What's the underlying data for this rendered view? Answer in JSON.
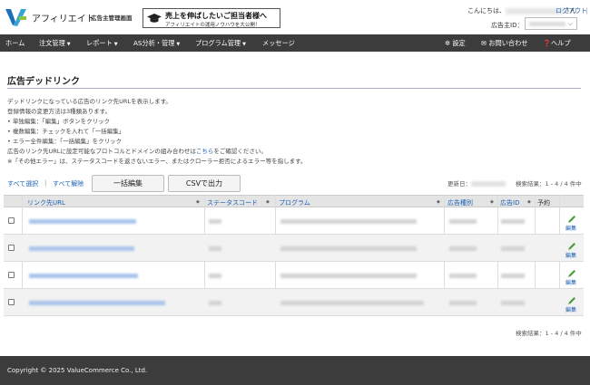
{
  "header": {
    "logo_text": "アフィリエイト",
    "logo_sub": "広告主管理画面",
    "banner_line1": "売上を伸ばしたいご担当者様へ",
    "banner_line2": "アフィリエイトの運用ノウハウを大公開！",
    "greeting_prefix": "こんにちは、",
    "greeting_suffix": "さん",
    "separator": "|",
    "logout": "ログアウト",
    "advertiser_label": "広告主ID："
  },
  "nav": {
    "items": [
      {
        "label": "ホーム",
        "caret": false
      },
      {
        "label": "注文管理",
        "caret": true
      },
      {
        "label": "レポート",
        "caret": true
      },
      {
        "label": "AS分析・管理",
        "caret": true
      },
      {
        "label": "プログラム管理",
        "caret": true
      },
      {
        "label": "メッセージ",
        "caret": false
      }
    ],
    "right": [
      {
        "label": "設定",
        "icon": "gear-icon"
      },
      {
        "label": "お問い合わせ",
        "icon": "mail-icon"
      },
      {
        "label": "ヘルプ",
        "icon": "help-icon"
      }
    ]
  },
  "page": {
    "title": "広告デッドリンク",
    "desc": [
      "デッドリンクになっている広告のリンク先URLを表示します。",
      "登録情報の変更方法は3種類あります。",
      "• 単独編集：「編集」ボタンをクリック",
      "• 複数編集：チェックを入れて「一括編集」",
      "• エラー全件編集：「一括編集」をクリック",
      "広告のリンク先URLに設定可能なプロトコルとドメインの組み合わせは",
      "※「その他エラー」は、ステータスコードを返さないエラー、またはクローラー拒否によるエラー等を指します。"
    ],
    "desc_link": "こちら",
    "desc_link_tail": "をご確認ください。"
  },
  "toolbar": {
    "select_all": "すべて選択",
    "separator": "|",
    "deselect_all": "すべて解除",
    "bulk_edit": "一括編集",
    "csv_export": "CSVで出力",
    "updated_label": "更新日：",
    "count": "検索結果：1 - 4 / 4 件中"
  },
  "table": {
    "headers": [
      "リンク先URL",
      "ステータスコード",
      "プログラム",
      "広告種別",
      "広告ID",
      "予約"
    ],
    "edit_label": "編集",
    "rows": 4
  },
  "footer": {
    "copyright": "Copyright © 2025 ValueCommerce Co., Ltd."
  },
  "colors": {
    "nav_bg": "#3c3c3c",
    "link": "#1a5fb4",
    "title_rule": "#b7a7cf",
    "edit_pen": "#4a9a3a"
  }
}
